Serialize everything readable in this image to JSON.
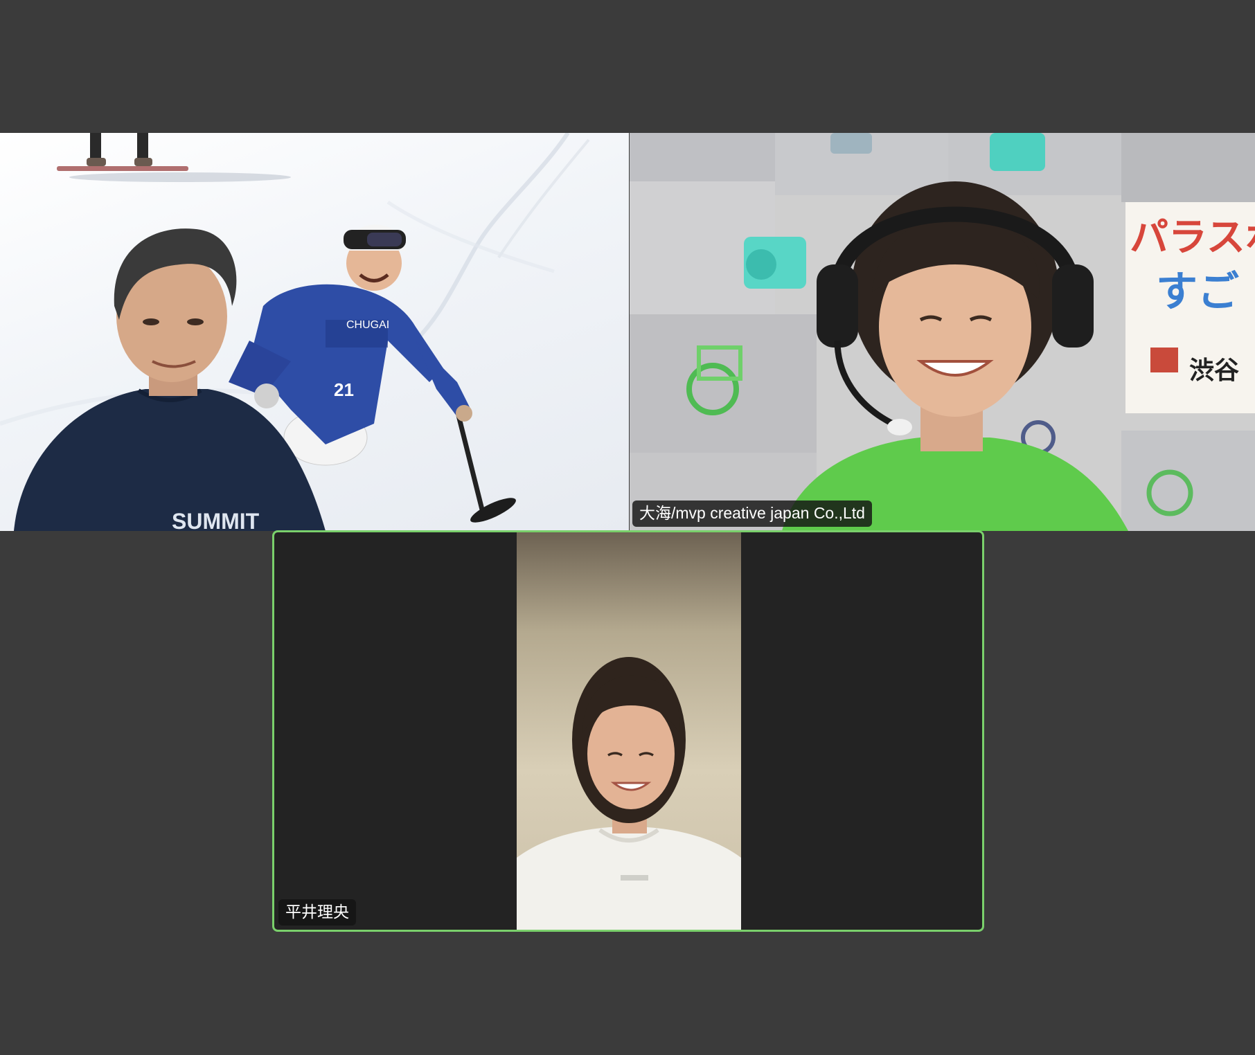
{
  "meeting": {
    "background_color": "#3b3b3b",
    "active_speaker_border_color": "#7ad06b"
  },
  "participants": [
    {
      "id": "tile-1",
      "name": "",
      "scene": "ski-background-with-man-in-navy-shirt",
      "shirt_text": "SUMMIT",
      "skier_bib_number": "21",
      "skier_logo_text": "CHUGAI",
      "active_speaker": false
    },
    {
      "id": "tile-2",
      "name": "大海/mvp creative japan Co.,Ltd",
      "scene": "woman-with-headset-green-shirt",
      "poster_text_line1": "パラスポ",
      "poster_text_line2": "すご",
      "poster_footer_text": "渋谷",
      "active_speaker": false
    },
    {
      "id": "tile-3",
      "name": "平井理央",
      "scene": "woman-in-white-sweatshirt-portrait",
      "active_speaker": true
    }
  ]
}
